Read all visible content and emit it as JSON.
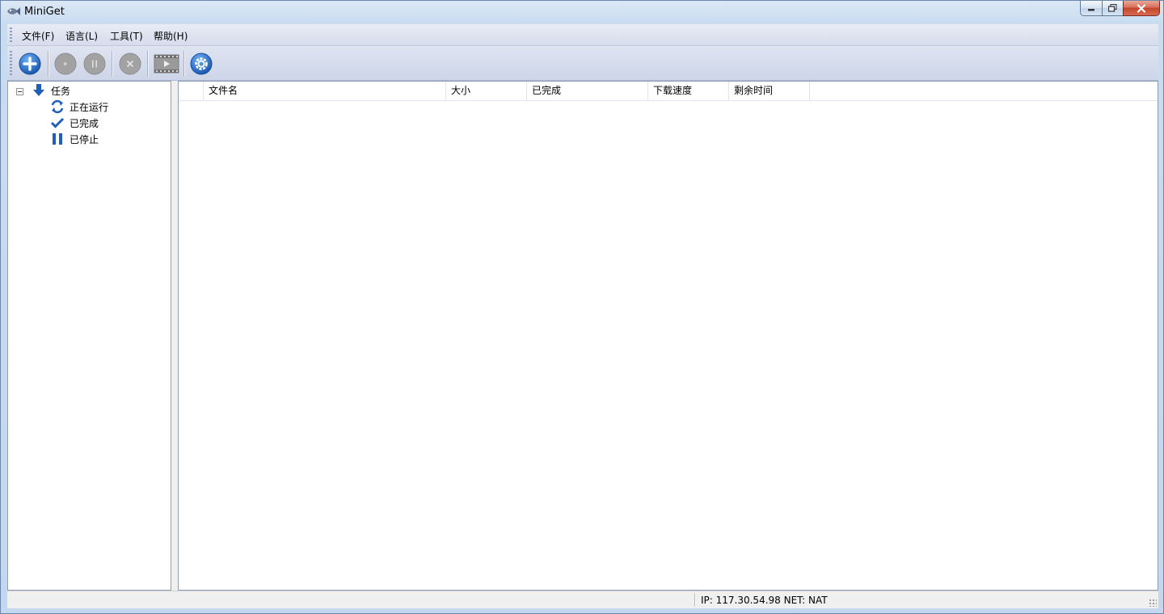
{
  "window": {
    "title": "MiniGet"
  },
  "menu": {
    "items": [
      {
        "label": "文件(F)"
      },
      {
        "label": "语言(L)"
      },
      {
        "label": "工具(T)"
      },
      {
        "label": "帮助(H)"
      }
    ]
  },
  "toolbar": {
    "buttons": [
      {
        "icon": "add-task-icon",
        "enabled": true
      },
      {
        "icon": "start-icon",
        "enabled": false
      },
      {
        "icon": "pause-icon",
        "enabled": false
      },
      {
        "icon": "delete-icon",
        "enabled": false
      },
      {
        "icon": "preview-video-icon",
        "enabled": false
      },
      {
        "icon": "settings-icon",
        "enabled": true
      }
    ]
  },
  "tree": {
    "root": {
      "label": "任务",
      "icon": "download-arrow-icon",
      "expanded": true
    },
    "children": [
      {
        "label": "正在运行",
        "icon": "refresh-icon"
      },
      {
        "label": "已完成",
        "icon": "checkmark-icon"
      },
      {
        "label": "已停止",
        "icon": "pause-icon"
      }
    ]
  },
  "list": {
    "columns": [
      {
        "label": ""
      },
      {
        "label": "文件名"
      },
      {
        "label": "大小"
      },
      {
        "label": "已完成"
      },
      {
        "label": "下载速度"
      },
      {
        "label": "剩余时间"
      }
    ],
    "rows": []
  },
  "status": {
    "text": "IP: 117.30.54.98 NET: NAT"
  },
  "colors": {
    "accent_blue": "#1f5fb8",
    "disabled_gray": "#9b9b9b",
    "close_red": "#c3452c"
  }
}
